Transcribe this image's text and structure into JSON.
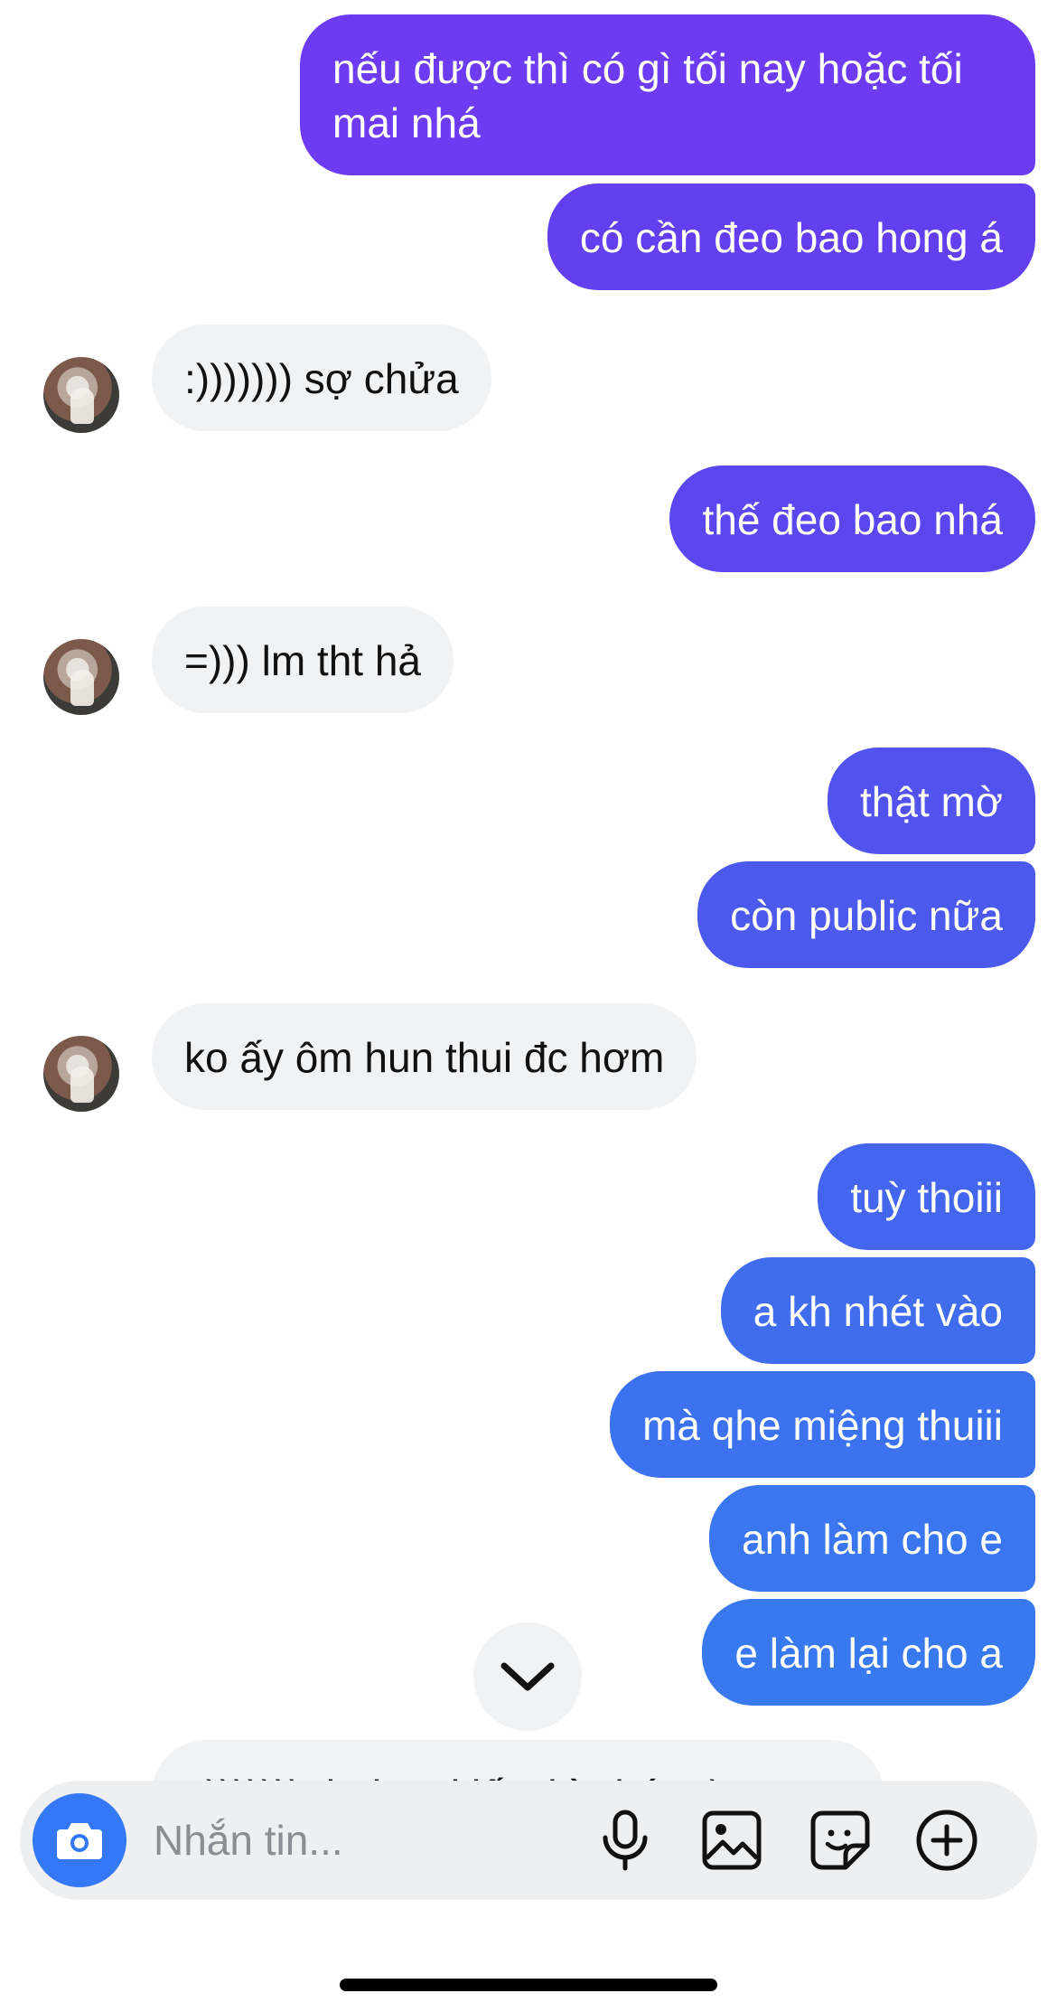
{
  "messages": [
    {
      "dir": "out",
      "text": "nếu được thì có gì tối nay hoặc tối\nmai nhá",
      "color": "#6d3cf2"
    },
    {
      "dir": "out",
      "text": "có cần đeo bao hong á",
      "color": "#633ff0"
    },
    {
      "dir": "in",
      "text": ":))))))) sợ chửa"
    },
    {
      "dir": "out",
      "text": "thế đeo bao nhá",
      "color": "#5a47ef"
    },
    {
      "dir": "in",
      "text": "=))) lm tht hả"
    },
    {
      "dir": "out",
      "text": "thật mờ",
      "color": "#5253ee"
    },
    {
      "dir": "out",
      "text": "còn public nữa",
      "color": "#4c59ed"
    },
    {
      "dir": "in",
      "text": "ko ấy ôm hun thui đc hơm"
    },
    {
      "dir": "out",
      "text": "tuỳ thoiii",
      "color": "#4466ee"
    },
    {
      "dir": "out",
      "text": "a kh nhét vào",
      "color": "#406cee"
    },
    {
      "dir": "out",
      "text": "mà qhe miệng thuiii",
      "color": "#3c72ef"
    },
    {
      "dir": "out",
      "text": "anh làm cho e",
      "color": "#3a76f0"
    },
    {
      "dir": "out",
      "text": "e làm lại cho a",
      "color": "#3879f0"
    }
  ],
  "partial_message": "))))))) thui mai lấy thì chét tr)",
  "composer": {
    "placeholder": "Nhắn tin...",
    "camera_icon": "camera-icon",
    "icons": [
      "microphone-icon",
      "image-icon",
      "sticker-icon",
      "plus-circle-icon"
    ]
  },
  "scroll_button_icon": "chevron-down-icon",
  "colors": {
    "incoming_bubble": "#f1f2f4",
    "camera_button": "#3478f6",
    "composer_bg": "#eeeff1"
  }
}
